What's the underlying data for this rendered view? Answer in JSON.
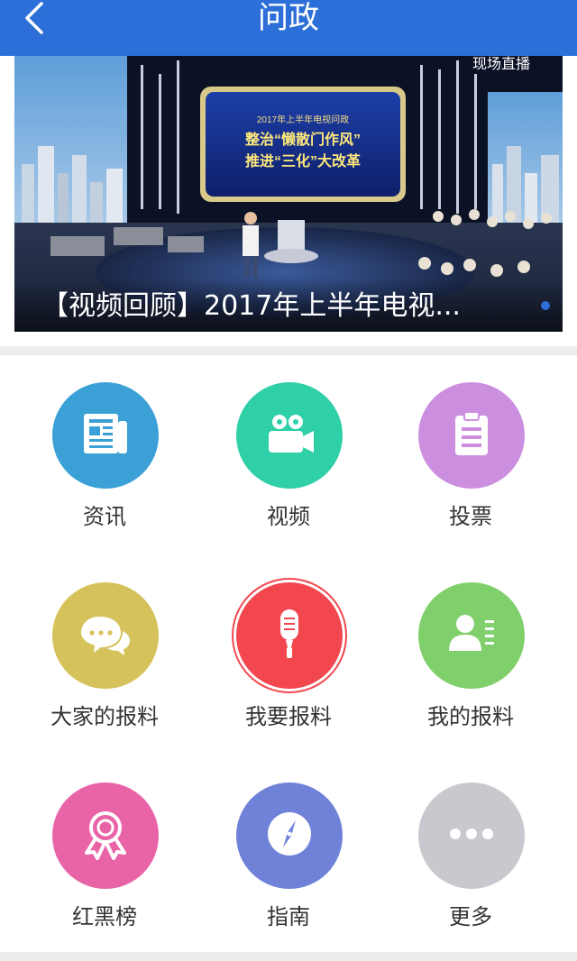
{
  "header": {
    "title": "问政",
    "back_icon": "chevron-left-icon"
  },
  "banner": {
    "caption": "【视频回顾】2017年上半年电视...",
    "screen_line1": "2017年上半年电视问政",
    "screen_line2": "整治“懒散门作风”",
    "screen_line3": "推进“三化”大改革",
    "corner_text": "现场直播",
    "active_dot_color": "#2d6fd8"
  },
  "menu": {
    "items": [
      {
        "label": "资讯",
        "icon": "newspaper-icon",
        "color": "#3ba0d6"
      },
      {
        "label": "视频",
        "icon": "video-camera-icon",
        "color": "#2fcfa8"
      },
      {
        "label": "投票",
        "icon": "clipboard-icon",
        "color": "#cc8fe0"
      },
      {
        "label": "大家的报料",
        "icon": "chat-bubbles-icon",
        "color": "#d6c25a"
      },
      {
        "label": "我要报料",
        "icon": "microphone-icon",
        "color": "#f2474e"
      },
      {
        "label": "我的报料",
        "icon": "user-list-icon",
        "color": "#7fcf6a"
      },
      {
        "label": "红黑榜",
        "icon": "award-ribbon-icon",
        "color": "#e864a7"
      },
      {
        "label": "指南",
        "icon": "compass-icon",
        "color": "#6f82d8"
      },
      {
        "label": "更多",
        "icon": "more-dots-icon",
        "color": "#c9c8ce"
      }
    ]
  }
}
